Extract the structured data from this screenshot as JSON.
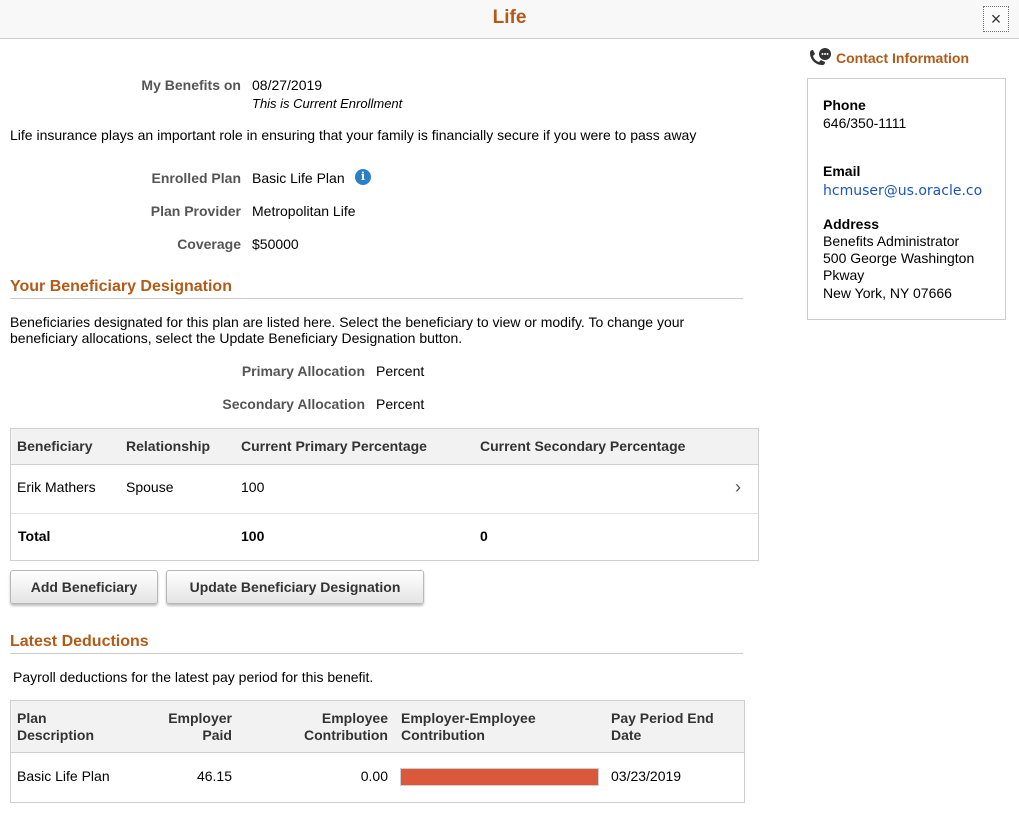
{
  "header": {
    "title": "Life",
    "close_label": "×"
  },
  "benefits": {
    "my_benefits_label": "My Benefits on",
    "date": "08/27/2019",
    "enrollment_note": "This is Current Enrollment",
    "intro": "Life insurance plays an important role in ensuring that your family is financially secure if you were to pass away",
    "enrolled_plan_label": "Enrolled Plan",
    "enrolled_plan": "Basic Life Plan",
    "plan_provider_label": "Plan Provider",
    "plan_provider": "Metropolitan Life",
    "coverage_label": "Coverage",
    "coverage": "$50000"
  },
  "beneficiary": {
    "section_title": "Your Beneficiary Designation",
    "description_line1": "Beneficiaries designated for this plan are listed here. Select the beneficiary to view or modify. To change your",
    "description_line2": "beneficiary allocations, select the Update Beneficiary Designation button.",
    "primary_allocation_label": "Primary Allocation",
    "primary_allocation": "Percent",
    "secondary_allocation_label": "Secondary Allocation",
    "secondary_allocation": "Percent",
    "columns": [
      "Beneficiary",
      "Relationship",
      "Current Primary Percentage",
      "Current Secondary Percentage"
    ],
    "rows": [
      {
        "name": "Erik Mathers",
        "relationship": "Spouse",
        "primary": "100",
        "secondary": ""
      }
    ],
    "total": {
      "label": "Total",
      "primary": "100",
      "secondary": "0"
    },
    "add_button": "Add Beneficiary",
    "update_button": "Update Beneficiary Designation"
  },
  "deductions": {
    "section_title": "Latest Deductions",
    "description": "Payroll deductions for the latest pay period for this benefit.",
    "col_plan_1": "Plan",
    "col_plan_2": "Description",
    "col_employer_1": "Employer",
    "col_employer_2": "Paid",
    "col_employee_1": "Employee",
    "col_employee_2": "Contribution",
    "col_ratio_1": "Employer-Employee",
    "col_ratio_2": "Contribution",
    "col_date_1": "Pay Period End",
    "col_date_2": "Date",
    "rows": [
      {
        "plan": "Basic Life Plan",
        "employer_paid": "46.15",
        "employee_contribution": "0.00",
        "employer_share": 1.0,
        "pay_period_end": "03/23/2019"
      }
    ],
    "bar_color": "#d9593a"
  },
  "contact": {
    "title": "Contact Information",
    "phone_label": "Phone",
    "phone": "646/350-1111",
    "email_label": "Email",
    "email": "hcmuser@us.oracle.co",
    "address_label": "Address",
    "address_line1": "Benefits Administrator",
    "address_line2": "500 George Washington",
    "address_line3": "Pkway",
    "address_line4": "New York, NY 07666"
  },
  "colors": {
    "accent": "#b35a17",
    "link": "#1a56b8",
    "info_icon": "#2a7fc9"
  }
}
